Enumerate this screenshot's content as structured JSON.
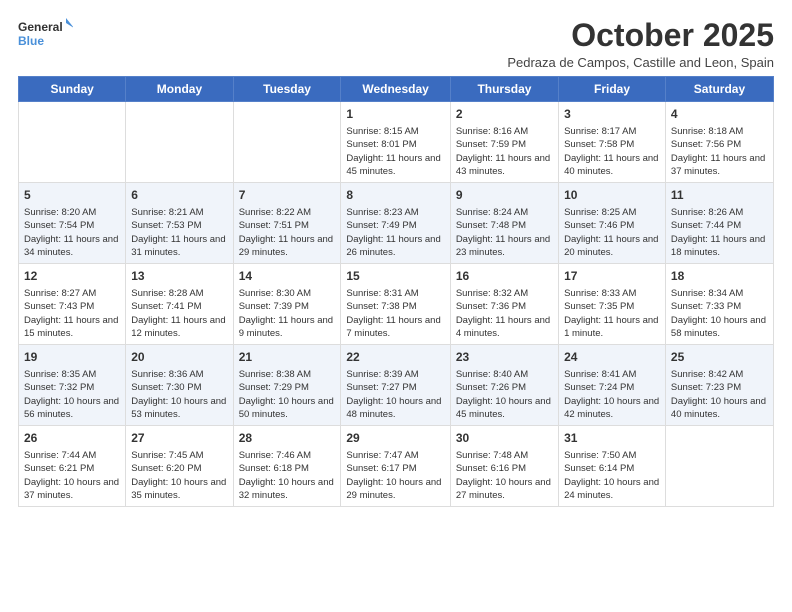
{
  "logo": {
    "text_general": "General",
    "text_blue": "Blue"
  },
  "title": "October 2025",
  "subtitle": "Pedraza de Campos, Castille and Leon, Spain",
  "days_header": [
    "Sunday",
    "Monday",
    "Tuesday",
    "Wednesday",
    "Thursday",
    "Friday",
    "Saturday"
  ],
  "weeks": [
    {
      "shade": false,
      "cells": [
        {
          "day": "",
          "info": ""
        },
        {
          "day": "",
          "info": ""
        },
        {
          "day": "",
          "info": ""
        },
        {
          "day": "1",
          "info": "Sunrise: 8:15 AM\nSunset: 8:01 PM\nDaylight: 11 hours and 45 minutes."
        },
        {
          "day": "2",
          "info": "Sunrise: 8:16 AM\nSunset: 7:59 PM\nDaylight: 11 hours and 43 minutes."
        },
        {
          "day": "3",
          "info": "Sunrise: 8:17 AM\nSunset: 7:58 PM\nDaylight: 11 hours and 40 minutes."
        },
        {
          "day": "4",
          "info": "Sunrise: 8:18 AM\nSunset: 7:56 PM\nDaylight: 11 hours and 37 minutes."
        }
      ]
    },
    {
      "shade": true,
      "cells": [
        {
          "day": "5",
          "info": "Sunrise: 8:20 AM\nSunset: 7:54 PM\nDaylight: 11 hours and 34 minutes."
        },
        {
          "day": "6",
          "info": "Sunrise: 8:21 AM\nSunset: 7:53 PM\nDaylight: 11 hours and 31 minutes."
        },
        {
          "day": "7",
          "info": "Sunrise: 8:22 AM\nSunset: 7:51 PM\nDaylight: 11 hours and 29 minutes."
        },
        {
          "day": "8",
          "info": "Sunrise: 8:23 AM\nSunset: 7:49 PM\nDaylight: 11 hours and 26 minutes."
        },
        {
          "day": "9",
          "info": "Sunrise: 8:24 AM\nSunset: 7:48 PM\nDaylight: 11 hours and 23 minutes."
        },
        {
          "day": "10",
          "info": "Sunrise: 8:25 AM\nSunset: 7:46 PM\nDaylight: 11 hours and 20 minutes."
        },
        {
          "day": "11",
          "info": "Sunrise: 8:26 AM\nSunset: 7:44 PM\nDaylight: 11 hours and 18 minutes."
        }
      ]
    },
    {
      "shade": false,
      "cells": [
        {
          "day": "12",
          "info": "Sunrise: 8:27 AM\nSunset: 7:43 PM\nDaylight: 11 hours and 15 minutes."
        },
        {
          "day": "13",
          "info": "Sunrise: 8:28 AM\nSunset: 7:41 PM\nDaylight: 11 hours and 12 minutes."
        },
        {
          "day": "14",
          "info": "Sunrise: 8:30 AM\nSunset: 7:39 PM\nDaylight: 11 hours and 9 minutes."
        },
        {
          "day": "15",
          "info": "Sunrise: 8:31 AM\nSunset: 7:38 PM\nDaylight: 11 hours and 7 minutes."
        },
        {
          "day": "16",
          "info": "Sunrise: 8:32 AM\nSunset: 7:36 PM\nDaylight: 11 hours and 4 minutes."
        },
        {
          "day": "17",
          "info": "Sunrise: 8:33 AM\nSunset: 7:35 PM\nDaylight: 11 hours and 1 minute."
        },
        {
          "day": "18",
          "info": "Sunrise: 8:34 AM\nSunset: 7:33 PM\nDaylight: 10 hours and 58 minutes."
        }
      ]
    },
    {
      "shade": true,
      "cells": [
        {
          "day": "19",
          "info": "Sunrise: 8:35 AM\nSunset: 7:32 PM\nDaylight: 10 hours and 56 minutes."
        },
        {
          "day": "20",
          "info": "Sunrise: 8:36 AM\nSunset: 7:30 PM\nDaylight: 10 hours and 53 minutes."
        },
        {
          "day": "21",
          "info": "Sunrise: 8:38 AM\nSunset: 7:29 PM\nDaylight: 10 hours and 50 minutes."
        },
        {
          "day": "22",
          "info": "Sunrise: 8:39 AM\nSunset: 7:27 PM\nDaylight: 10 hours and 48 minutes."
        },
        {
          "day": "23",
          "info": "Sunrise: 8:40 AM\nSunset: 7:26 PM\nDaylight: 10 hours and 45 minutes."
        },
        {
          "day": "24",
          "info": "Sunrise: 8:41 AM\nSunset: 7:24 PM\nDaylight: 10 hours and 42 minutes."
        },
        {
          "day": "25",
          "info": "Sunrise: 8:42 AM\nSunset: 7:23 PM\nDaylight: 10 hours and 40 minutes."
        }
      ]
    },
    {
      "shade": false,
      "cells": [
        {
          "day": "26",
          "info": "Sunrise: 7:44 AM\nSunset: 6:21 PM\nDaylight: 10 hours and 37 minutes."
        },
        {
          "day": "27",
          "info": "Sunrise: 7:45 AM\nSunset: 6:20 PM\nDaylight: 10 hours and 35 minutes."
        },
        {
          "day": "28",
          "info": "Sunrise: 7:46 AM\nSunset: 6:18 PM\nDaylight: 10 hours and 32 minutes."
        },
        {
          "day": "29",
          "info": "Sunrise: 7:47 AM\nSunset: 6:17 PM\nDaylight: 10 hours and 29 minutes."
        },
        {
          "day": "30",
          "info": "Sunrise: 7:48 AM\nSunset: 6:16 PM\nDaylight: 10 hours and 27 minutes."
        },
        {
          "day": "31",
          "info": "Sunrise: 7:50 AM\nSunset: 6:14 PM\nDaylight: 10 hours and 24 minutes."
        },
        {
          "day": "",
          "info": ""
        }
      ]
    }
  ]
}
